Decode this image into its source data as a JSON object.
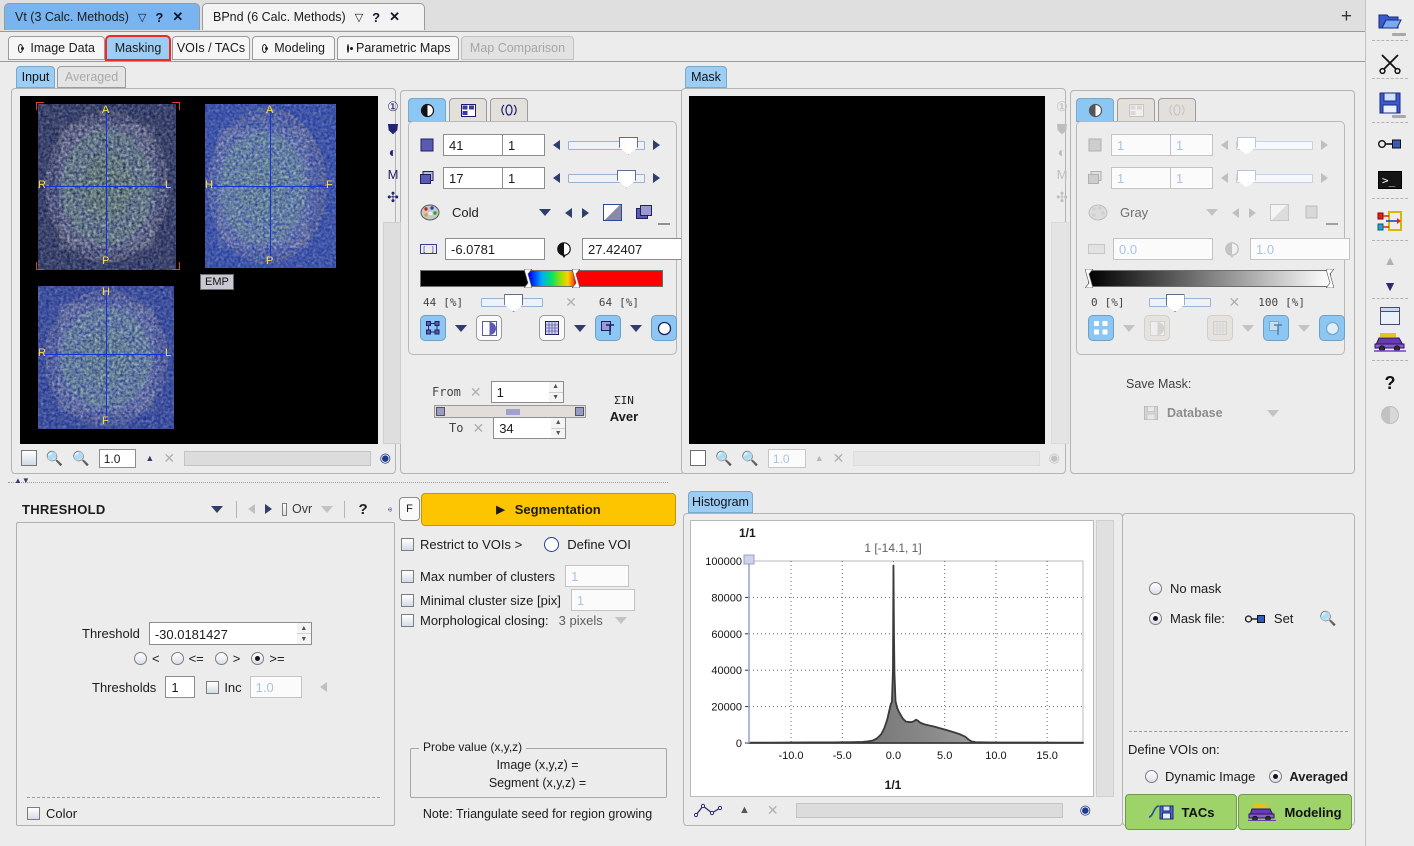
{
  "window_tabs": [
    {
      "label": "Vt (3 Calc. Methods)",
      "active": true
    },
    {
      "label": "BPnd (6 Calc. Methods)",
      "active": false
    }
  ],
  "window_tab_icons": {
    "menu": "▽",
    "help": "?",
    "close": "✕",
    "add": "+"
  },
  "module_tabs": [
    {
      "label": "Image Data",
      "has_dot": true,
      "state": "normal"
    },
    {
      "label": "Masking",
      "has_dot": false,
      "state": "selected"
    },
    {
      "label": "VOIs / TACs",
      "has_dot": false,
      "state": "normal"
    },
    {
      "label": "Modeling",
      "has_dot": true,
      "state": "normal"
    },
    {
      "label": "Parametric Maps",
      "has_dot": true,
      "state": "normal"
    },
    {
      "label": "Map Comparison",
      "has_dot": false,
      "state": "disabled"
    }
  ],
  "image_panel": {
    "tabs": [
      {
        "label": "Input",
        "selected": true
      },
      {
        "label": "Averaged",
        "selected": false
      }
    ],
    "overlay_label": "EMP",
    "orient_labels": {
      "a": "A",
      "p": "P",
      "r": "R",
      "l": "L",
      "h": "H",
      "f": "F"
    },
    "zoom_value": "1.0",
    "side_icons": [
      "info-icon",
      "layout-icon",
      "contrast-icon",
      "m-icon",
      "crosshair-icon"
    ]
  },
  "image_controls": {
    "tabs": [
      "contrast-tab",
      "layout-tab",
      "motion-tab"
    ],
    "slice_icon": "plane-icon",
    "frame_icon": "stack-icon",
    "slice_value": "41",
    "slice_step": "1",
    "frame_value": "17",
    "frame_step": "1",
    "palette_name": "Cold",
    "min_value": "-6.0781",
    "max_value": "27.42407",
    "low_pct": "44",
    "high_pct": "64",
    "pct_unit": "[%]",
    "from_label": "From",
    "to_label": "To",
    "from_value": "1",
    "to_value": "34",
    "aver_label_top": "ΣIN",
    "aver_label": "Aver",
    "colorbar": {
      "black_stop": 44,
      "rainbow_end": 64,
      "colors": [
        "#000000",
        "#0000ff",
        "#00c8ff",
        "#00e070",
        "#c8f000",
        "#ffd000",
        "#ff5000",
        "#ff0000"
      ]
    }
  },
  "mask_panel": {
    "tab_label": "Mask",
    "zoom_value": "1.0",
    "side_icons": [
      "info-icon",
      "layout-icon",
      "contrast-icon",
      "m-icon",
      "crosshair-icon"
    ]
  },
  "mask_controls": {
    "slice_value": "1",
    "slice_step": "1",
    "frame_value": "1",
    "frame_step": "1",
    "palette_name": "Gray",
    "min_value": "0.0",
    "max_value": "1.0",
    "low_pct": "0",
    "high_pct": "100",
    "pct_unit": "[%]",
    "save_mask_label": "Save Mask:",
    "database_label": "Database"
  },
  "threshold_panel": {
    "title": "THRESHOLD",
    "ovr_label": "Ovr",
    "help_label": "?",
    "threshold_label": "Threshold",
    "threshold_value": "-30.0181427",
    "operators": [
      {
        "label": "<",
        "selected": false
      },
      {
        "label": "<=",
        "selected": false
      },
      {
        "label": ">",
        "selected": false
      },
      {
        "label": ">=",
        "selected": true
      }
    ],
    "thresholds_label": "Thresholds",
    "thresholds_value": "1",
    "inc_label": "Inc",
    "inc_value": "1.0",
    "color_label": "Color"
  },
  "segmentation_panel": {
    "f_button": "F",
    "segmentation_label": "Segmentation",
    "restrict_label": "Restrict to VOIs >",
    "define_voi_label": "Define VOI",
    "max_clusters_label": "Max number of clusters",
    "max_clusters_value": "1",
    "min_cluster_label": "Minimal cluster size [pix]",
    "min_cluster_value": "1",
    "morph_label": "Morphological closing:",
    "morph_value": "3 pixels",
    "probe_group_label": "Probe value (x,y,z)",
    "probe_image_label": "Image (x,y,z) =",
    "probe_segment_label": "Segment (x,y,z) =",
    "note": "Note: Triangulate seed for region growing"
  },
  "histogram_panel": {
    "tab_label": "Histogram",
    "corner_label": "1/1",
    "bottom_label": "1/1",
    "range_label": "1 [-14.1, 1]"
  },
  "chart_data": {
    "type": "area",
    "title": "1 [-14.1, 1]",
    "xlabel": "1/1",
    "ylabel": "",
    "xlim": [
      -14.1,
      18.5
    ],
    "ylim": [
      0,
      100000
    ],
    "xticks": [
      "-10.0",
      "-5.0",
      "0.0",
      "5.0",
      "10.0",
      "15.0"
    ],
    "xtick_values": [
      -10,
      -5,
      0,
      5,
      10,
      15
    ],
    "yticks": [
      "0",
      "20000",
      "40000",
      "60000",
      "80000",
      "100000"
    ],
    "ytick_values": [
      0,
      20000,
      40000,
      60000,
      80000,
      100000
    ],
    "grid": true,
    "legend": "none",
    "x": [
      -14.1,
      -12.0,
      -10.0,
      -8.0,
      -6.0,
      -4.0,
      -3.0,
      -2.5,
      -2.0,
      -1.6,
      -1.2,
      -0.9,
      -0.6,
      -0.4,
      -0.25,
      -0.15,
      -0.05,
      0.0,
      0.05,
      0.1,
      0.2,
      0.35,
      0.5,
      0.7,
      0.9,
      1.2,
      1.5,
      1.8,
      2.0,
      2.2,
      2.4,
      2.6,
      3.0,
      3.5,
      4.0,
      4.5,
      5.0,
      5.5,
      6.0,
      6.5,
      7.0,
      7.3,
      7.6,
      8.0,
      9.0,
      10.5,
      12.0,
      14.0,
      16.0,
      18.5
    ],
    "y": [
      200,
      200,
      250,
      300,
      350,
      450,
      600,
      900,
      1400,
      2600,
      4800,
      8000,
      13000,
      18000,
      21500,
      22500,
      40000,
      97500,
      60000,
      38000,
      23000,
      19500,
      17500,
      15500,
      13500,
      11800,
      11500,
      11500,
      12000,
      12800,
      12200,
      11200,
      10300,
      9600,
      9000,
      8200,
      7400,
      6600,
      5700,
      4800,
      3500,
      2000,
      900,
      450,
      330,
      280,
      250,
      230,
      220,
      200
    ]
  },
  "mask_options": {
    "no_mask_label": "No mask",
    "mask_file_label": "Mask file:",
    "set_label": "Set",
    "define_vois_label": "Define VOIs on:",
    "dynamic_label": "Dynamic Image",
    "averaged_label": "Averaged",
    "tacs_button": "TACs",
    "modeling_button": "Modeling",
    "no_mask_selected": false,
    "mask_file_selected": true,
    "dynamic_selected": false,
    "averaged_selected": true
  },
  "right_toolbar": [
    {
      "name": "open-folder-icon"
    },
    {
      "name": "scissors-icon"
    },
    {
      "name": "save-disk-icon"
    },
    {
      "name": "key-icon"
    },
    {
      "name": "terminal-icon"
    },
    {
      "name": "pipeline-icon"
    },
    {
      "name": "up-triangle-icon"
    },
    {
      "name": "down-triangle-icon"
    },
    {
      "name": "window-icon"
    },
    {
      "name": "car-icon"
    },
    {
      "name": "help-icon"
    },
    {
      "name": "contrast-globe-icon"
    }
  ],
  "colors": {
    "accent_blue": "#9ccef5",
    "select_red": "#ef2a22",
    "segment_yellow": "#fdc500",
    "green_button": "#9ed36a",
    "panel_bg": "#ececed"
  }
}
